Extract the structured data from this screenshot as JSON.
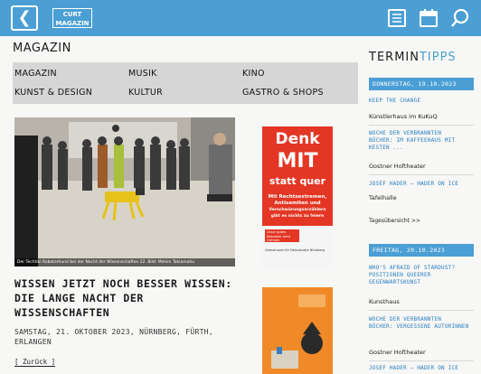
{
  "header": {
    "logo_line1": "CURT",
    "logo_line2": "MAGAZIN",
    "icons": [
      "back-arrow-icon",
      "newspaper-icon",
      "calendar-icon",
      "search-icon"
    ],
    "accent_color": "#4b9fd4"
  },
  "magazin": {
    "title": "MAGAZIN",
    "nav": [
      [
        "MAGAZIN",
        "MUSIK",
        "KINO"
      ],
      [
        "KUNST & DESIGN",
        "KULTUR",
        "GASTRO & SHOPS"
      ]
    ]
  },
  "article": {
    "photo_caption": "Der Techtiki Roboterhund bei der Nacht der Wissenschaften 22. Bild: Melvin Tokiamahu",
    "title_line1": "WISSEN JETZT NOCH BESSER WISSEN:",
    "title_line2": "DIE LANGE NACHT DER",
    "title_line3": "WISSENSCHAFTEN",
    "meta_line1": "SAMSTAG, 21. OKTOBER 2023, NÜRNBERG, FÜRTH,",
    "meta_line2": "ERLANGEN",
    "back_link": "[ Zurück ]"
  },
  "ad": {
    "line1": "Denk",
    "line2": "MIT",
    "line3": "statt quer",
    "sub1": "Mit Rechtsextremen,",
    "sub2": "Antisemiten und",
    "sub3": "Verschwörungserzählern",
    "sub4": "gibt es nichts zu feiern",
    "tag": "Unser gutes Netzwerk zieht Grenzen",
    "footer": "Gemeinsam für Demokratie Nürnberg"
  },
  "termin": {
    "title_a": "TERMIN",
    "title_b": "TIPPS",
    "day1": "DONNERSTAG, 19.10.2023",
    "day1_events": [
      {
        "title1": "KEEP THE CHANGE",
        "title2": "",
        "location": "Künstlerhaus im KuKuQ"
      },
      {
        "title1": "WOCHE DER VERBRANNTEN",
        "title2": "BÜCHER: IM KAFFEEHAUS MIT KESTEN ...",
        "location": "Gostner Hoftheater"
      },
      {
        "title1": "JOSEF HADER – HADER ON ICE",
        "title2": "",
        "location": "Tafelhalle"
      }
    ],
    "overview": "Tagesübersicht >>",
    "day2": "FREITAG, 20.10.2023",
    "day2_events": [
      {
        "title1": "WHO'S AFRAID OF STARDUST?",
        "title2": "POSITIONEN QUEERER GEGENWARTSKUNST",
        "location": "Kunsthaus"
      },
      {
        "title1": "WOCHE DER VERBRANNTEN",
        "title2": "BÜCHER: VERGESSENE AUTORINNEN",
        "location": "Gostner Hoftheater"
      },
      {
        "title1": "JOSEF HADER – HADER ON ICE",
        "title2": "",
        "location": ""
      }
    ]
  }
}
